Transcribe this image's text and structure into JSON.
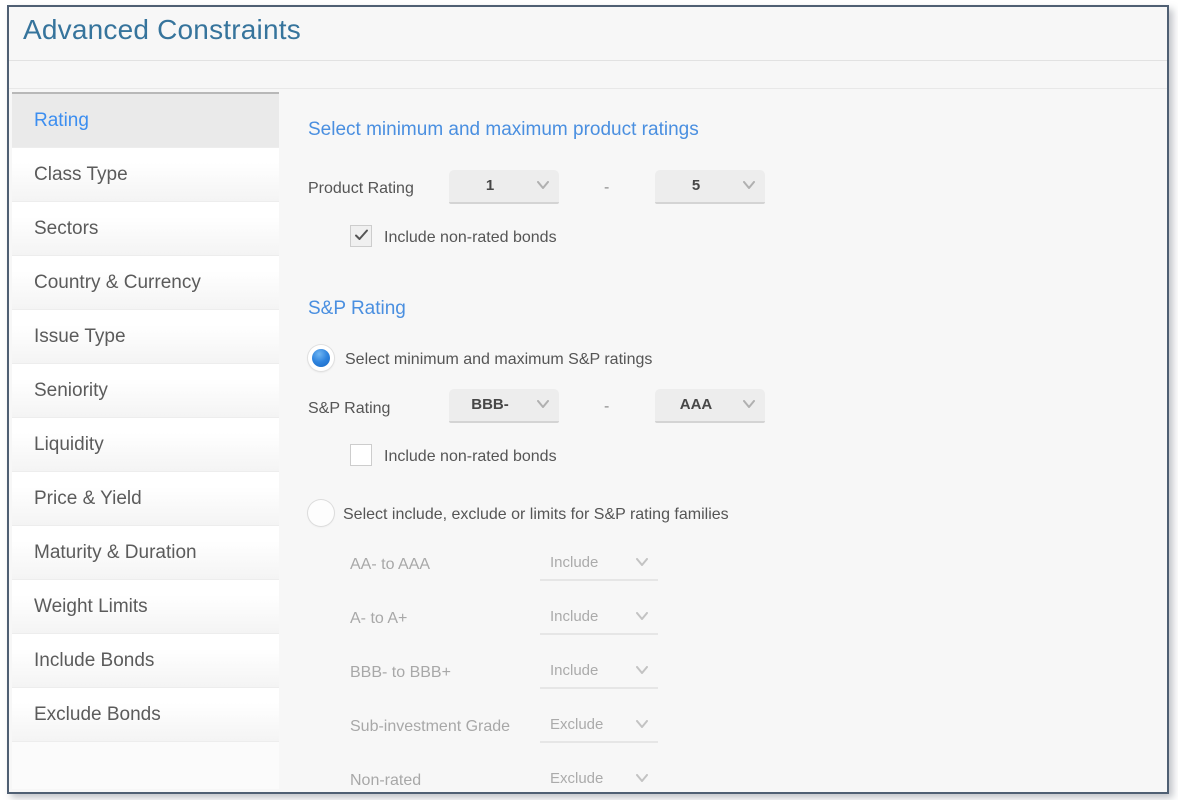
{
  "window": {
    "title": "Advanced Constraints"
  },
  "sidebar": {
    "items": [
      {
        "label": "Rating",
        "selected": true
      },
      {
        "label": "Class Type",
        "selected": false
      },
      {
        "label": "Sectors",
        "selected": false
      },
      {
        "label": "Country & Currency",
        "selected": false
      },
      {
        "label": "Issue Type",
        "selected": false
      },
      {
        "label": "Seniority",
        "selected": false
      },
      {
        "label": "Liquidity",
        "selected": false
      },
      {
        "label": "Price & Yield",
        "selected": false
      },
      {
        "label": "Maturity & Duration",
        "selected": false
      },
      {
        "label": "Weight Limits",
        "selected": false
      },
      {
        "label": "Include Bonds",
        "selected": false
      },
      {
        "label": "Exclude Bonds",
        "selected": false
      }
    ]
  },
  "main": {
    "product_rating": {
      "heading": "Select minimum and maximum product ratings",
      "row_label": "Product Rating",
      "min_value": "1",
      "max_value": "5",
      "separator": "-",
      "checkbox_label": "Include non-rated bonds",
      "checkbox_checked": "true"
    },
    "sp_rating": {
      "heading": "S&P Rating",
      "radio_minmax_label": "Select minimum and maximum S&P ratings",
      "radio_minmax_selected": "true",
      "row_label": "S&P Rating",
      "min_value": "BBB-",
      "max_value": "AAA",
      "separator": "-",
      "checkbox_label": "Include non-rated bonds",
      "checkbox_checked": "false",
      "radio_families_label": "Select include, exclude or limits for S&P rating families",
      "radio_families_selected": "false",
      "families": [
        {
          "label": "AA- to AAA",
          "value": "Include"
        },
        {
          "label": "A- to A+",
          "value": "Include"
        },
        {
          "label": "BBB- to BBB+",
          "value": "Include"
        },
        {
          "label": "Sub-investment Grade",
          "value": "Exclude"
        },
        {
          "label": "Non-rated",
          "value": "Exclude"
        }
      ]
    }
  },
  "colors": {
    "title": "#36749c",
    "section_heading": "#4a8fe0",
    "selected_item": "#3c8ef0",
    "radio_on": "#2f84de",
    "window_border": "#4f5f73"
  }
}
